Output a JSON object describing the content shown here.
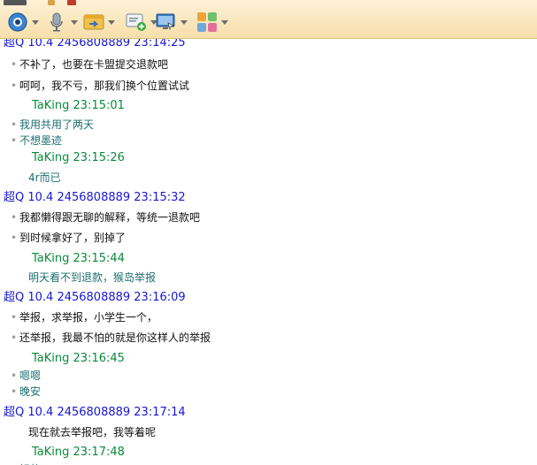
{
  "toolbar": {
    "icons": [
      "webcam-icon",
      "microphone-icon",
      "file-transfer-icon",
      "message-add-icon",
      "screen-share-icon",
      "apps-icon"
    ]
  },
  "chat": {
    "top_header": "超Q 10.4 2456808889  23:14:25",
    "lines": [
      {
        "type": "msg",
        "bullet": "•",
        "text": "不补了，也要在卡盟提交退款吧",
        "style": "msg"
      },
      {
        "type": "msg",
        "bullet": "•",
        "text": "呵呵，我不亏，那我们换个位置试试",
        "style": "msg"
      },
      {
        "type": "tk",
        "text": "TaKing   23:15:01"
      },
      {
        "type": "msg",
        "bullet": "•",
        "text": "我用共用了两天",
        "style": "teal"
      },
      {
        "type": "msg",
        "bullet": "•",
        "text": "不想墨迹",
        "style": "teal"
      },
      {
        "type": "tk",
        "text": "TaKing   23:15:26"
      },
      {
        "type": "msg",
        "bullet": "",
        "text": "4r而已",
        "style": "teal"
      },
      {
        "type": "hdr",
        "text": "超Q 10.4 2456808889  23:15:32"
      },
      {
        "type": "msg",
        "bullet": "•",
        "text": "我都懒得跟无聊的解释，等统一退款吧",
        "style": "msg"
      },
      {
        "type": "msg",
        "bullet": "•",
        "text": "到时候拿好了，别掉了",
        "style": "msg"
      },
      {
        "type": "tk",
        "text": "TaKing   23:15:44"
      },
      {
        "type": "msg",
        "bullet": "",
        "text": "明天看不到退款，猴岛举报",
        "style": "teal"
      },
      {
        "type": "hdr",
        "text": "超Q 10.4 2456808889  23:16:09"
      },
      {
        "type": "msg",
        "bullet": "•",
        "text": "举报，求举报，小学生一个，",
        "style": "msg"
      },
      {
        "type": "msg",
        "bullet": "•",
        "text": "还举报，我最不怕的就是你这样人的举报",
        "style": "msg"
      },
      {
        "type": "tk",
        "text": "TaKing   23:16:45"
      },
      {
        "type": "msg",
        "bullet": "•",
        "text": "嗯嗯",
        "style": "teal"
      },
      {
        "type": "msg",
        "bullet": "•",
        "text": "晚安",
        "style": "teal"
      },
      {
        "type": "hdr",
        "text": "超Q 10.4 2456808889  23:17:14"
      },
      {
        "type": "msg",
        "bullet": "",
        "text": "现在就去举报吧，我等着呢",
        "style": "msg"
      },
      {
        "type": "tk",
        "text": "TaKing   23:17:48"
      },
      {
        "type": "msg",
        "bullet": "•",
        "text": "好的",
        "style": "teal"
      }
    ]
  }
}
